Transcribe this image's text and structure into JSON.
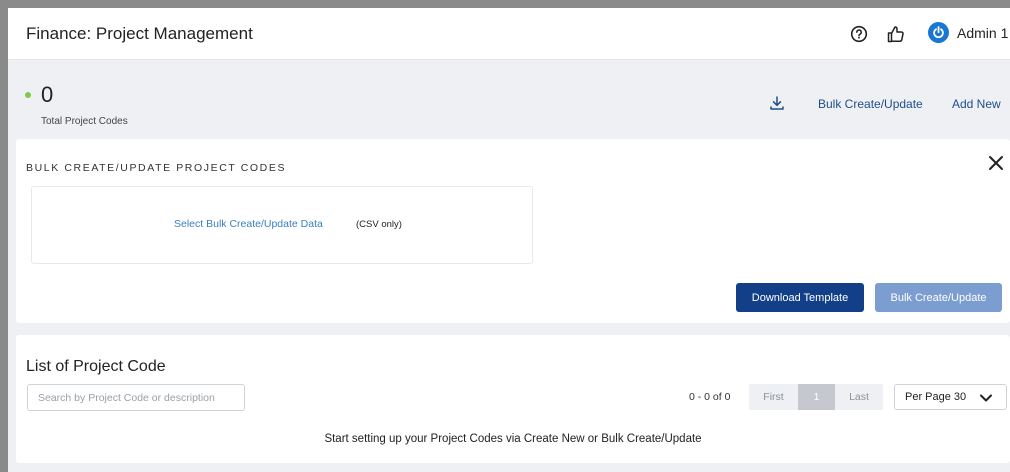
{
  "header": {
    "title": "Finance: Project Management",
    "help_icon": "question-circle-icon",
    "like_icon": "thumbs-up-icon",
    "user_icon": "power-icon",
    "user_name": "Admin 1"
  },
  "summary": {
    "count": "0",
    "count_label": "Total Project Codes",
    "download_icon": "download-icon",
    "bulk_link": "Bulk Create/Update",
    "add_link": "Add New"
  },
  "bulk_panel": {
    "title": "BULK CREATE/UPDATE PROJECT CODES",
    "select_link": "Select Bulk Create/Update Data",
    "select_note": "(CSV only)",
    "download_template": "Download Template",
    "bulk_button": "Bulk Create/Update"
  },
  "list_panel": {
    "title": "List of Project Code",
    "search_placeholder": "Search by Project Code or description",
    "range": "0 - 0 of 0",
    "pager": {
      "first": "First",
      "current": "1",
      "last": "Last"
    },
    "per_page": "Per Page 30",
    "empty_message": "Start setting up your Project Codes via Create New or Bulk Create/Update"
  },
  "colors": {
    "primary": "#123f87",
    "primary_disabled": "#7b9dcf",
    "link": "#1f4e8c",
    "status_dot": "#7ecb4c",
    "user_icon": "#1976d2"
  }
}
